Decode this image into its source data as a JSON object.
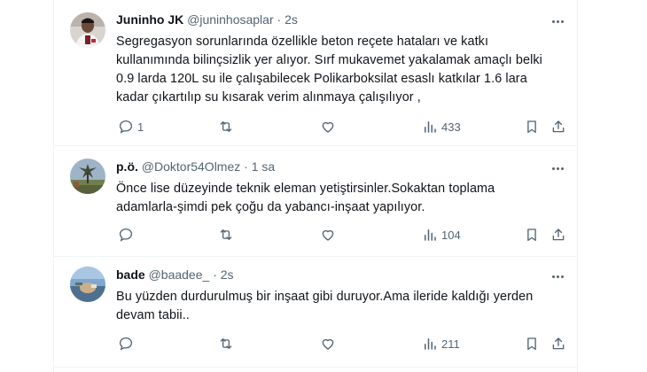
{
  "tweets": [
    {
      "name": "Juninho JK",
      "handle": "@juninhosaplar",
      "sep": "·",
      "time": "2s",
      "lines": [
        "Segregasyon sorunlarında özellikle beton reçete hataları ve katkı",
        "kullanımında bilinçsizlik yer alıyor. Sırf mukavemet yakalamak amaçlı  belki",
        "0.9 larda 120L su ile çalışabilecek Polikarboksilat esaslı katkılar 1.6 lara",
        "kadar çıkartılıp su kısarak verim alınmaya çalışılıyor ,"
      ],
      "replies": "1",
      "retweets": "",
      "likes": "",
      "views": "433"
    },
    {
      "name": "p.ö.",
      "handle": "@Doktor54Olmez",
      "sep": "·",
      "time": "1 sa",
      "lines": [
        "Önce lise düzeyinde teknik eleman yetiştirsinler.Sokaktan toplama",
        "adamlarla-şimdi pek çoğu da yabancı-inşaat yapılıyor."
      ],
      "replies": "",
      "retweets": "",
      "likes": "",
      "views": "104"
    },
    {
      "name": "bade",
      "handle": "@baadee_",
      "sep": "·",
      "time": "2s",
      "lines": [
        "Bu yüzden durdurulmuş bir inşaat gibi duruyor.Ama ileride kaldığı yerden",
        "devam tabii.."
      ],
      "replies": "",
      "retweets": "",
      "likes": "",
      "views": "211"
    }
  ],
  "icons": {
    "reply": "reply-icon",
    "retweet": "retweet-icon",
    "like": "heart-icon",
    "views": "views-chart-icon",
    "bookmark": "bookmark-icon",
    "share": "share-icon",
    "more": "more-dots-icon"
  },
  "colors": {
    "text": "#0f1419",
    "secondary": "#536471",
    "border": "#eff3f4"
  }
}
